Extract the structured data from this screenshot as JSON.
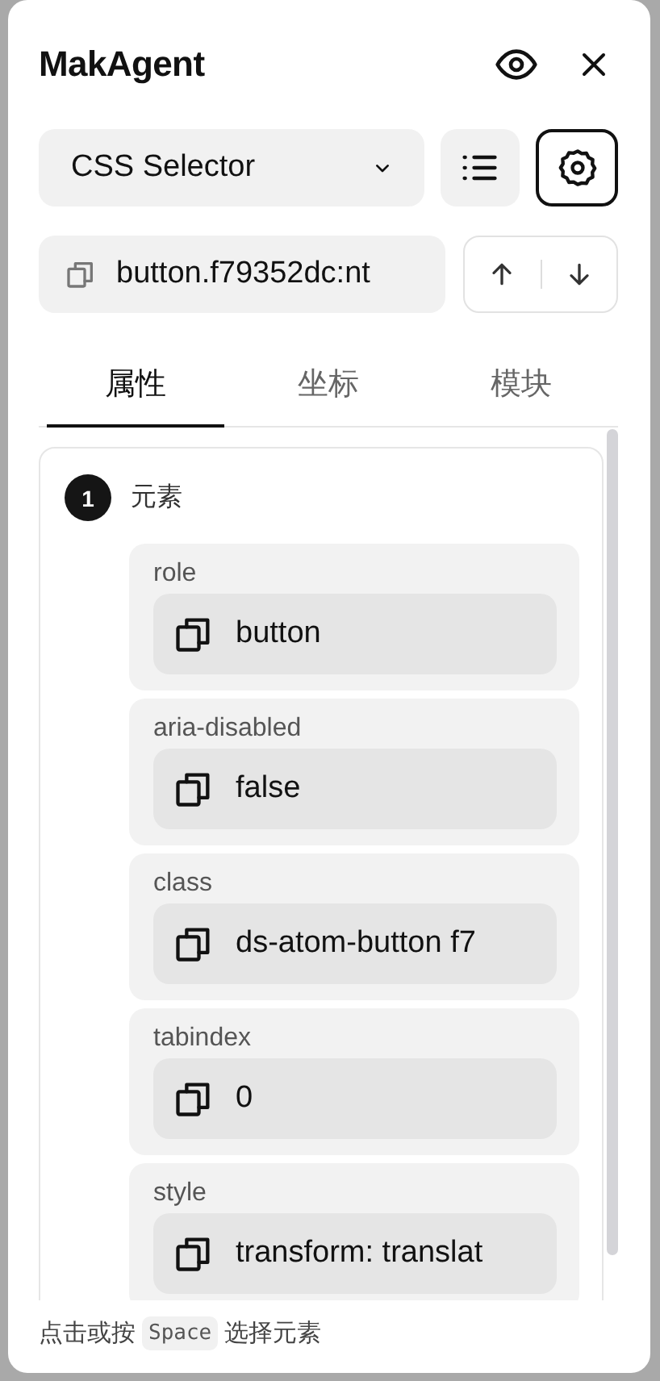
{
  "window": {
    "title": "MakAgent"
  },
  "selector": {
    "value": "CSS Selector"
  },
  "toolbar": [
    {
      "kind": "list",
      "selected": false
    },
    {
      "kind": "settings",
      "selected": true
    }
  ],
  "selector_field": {
    "value": "button.f79352dc:nt"
  },
  "tabs": [
    {
      "label": "属性",
      "selected": true
    },
    {
      "label": "坐标",
      "selected": false
    },
    {
      "label": "模块",
      "selected": false
    }
  ],
  "element": {
    "number": "1",
    "label": "元素",
    "attributes": [
      {
        "name": "role",
        "value": "button"
      },
      {
        "name": "aria-disabled",
        "value": "false"
      },
      {
        "name": "class",
        "value": "ds-atom-button f7"
      },
      {
        "name": "tabindex",
        "value": "0"
      },
      {
        "name": "style",
        "value": "transform: translat"
      }
    ]
  },
  "footer": {
    "before": "点击或按",
    "key": "Space",
    "after": "选择元素"
  }
}
